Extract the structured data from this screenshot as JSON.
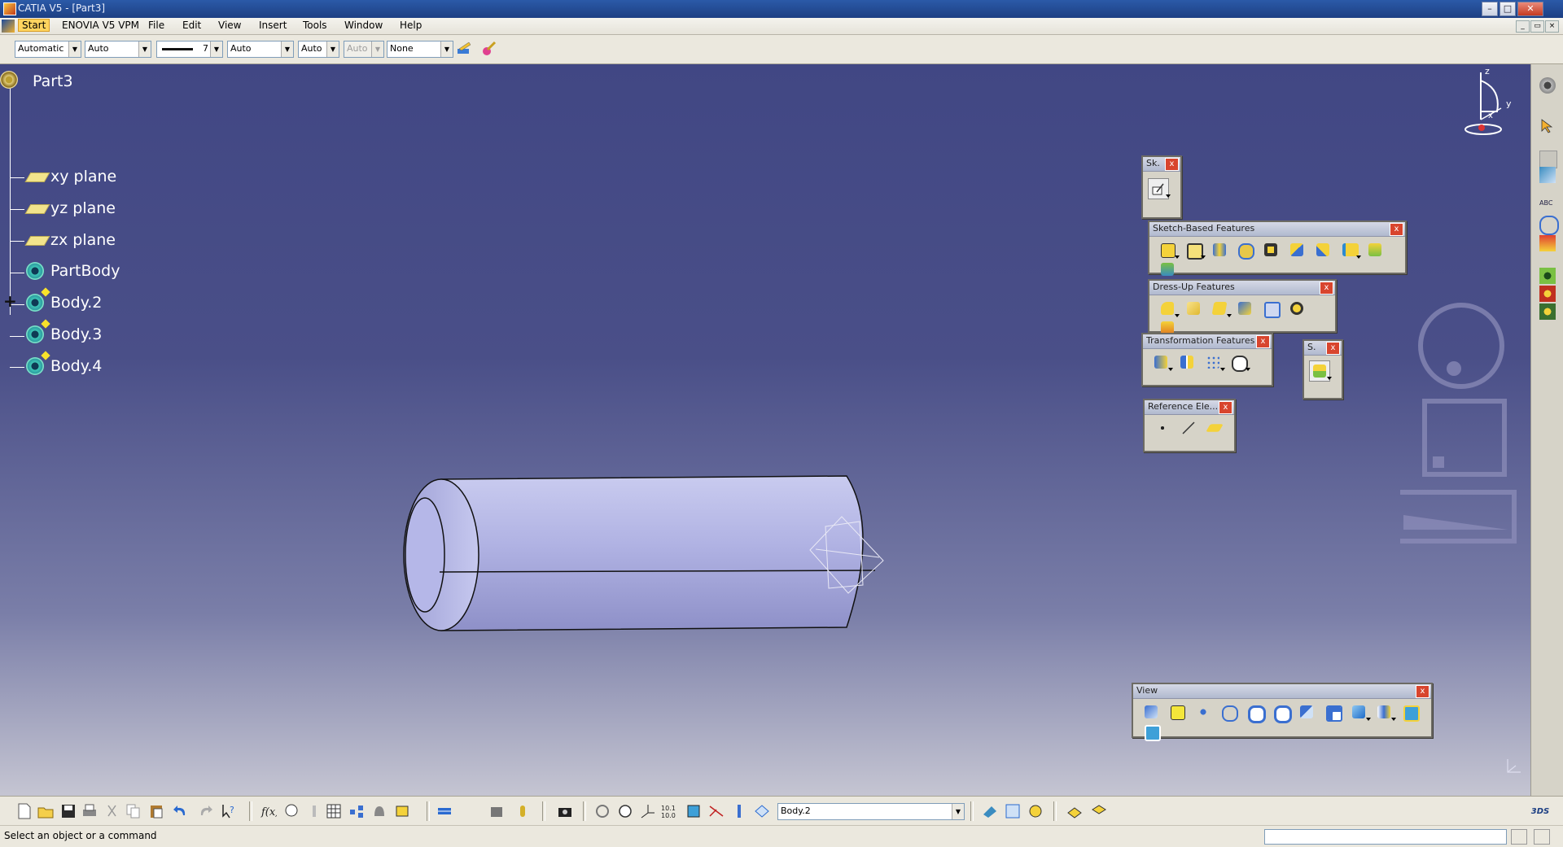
{
  "window": {
    "title": "CATIA V5 - [Part3]",
    "min": "–",
    "max": "□",
    "close": "✕"
  },
  "menu": {
    "items": [
      {
        "label": "Start"
      },
      {
        "label": "ENOVIA V5 VPM"
      },
      {
        "label": "File"
      },
      {
        "label": "Edit"
      },
      {
        "label": "View"
      },
      {
        "label": "Insert"
      },
      {
        "label": "Tools"
      },
      {
        "label": "Window"
      },
      {
        "label": "Help"
      }
    ]
  },
  "graphic_properties": {
    "fill_color": "Automatic",
    "transparency": "Auto",
    "line_weight": "7",
    "line_type": "Auto",
    "point_symbol": "Auto",
    "layer_disabled": "Auto",
    "layer": "None"
  },
  "tree": {
    "root": "Part3",
    "nodes": [
      {
        "label": "xy plane",
        "icon": "plane-icon"
      },
      {
        "label": "yz plane",
        "icon": "plane-icon"
      },
      {
        "label": "zx plane",
        "icon": "plane-icon"
      },
      {
        "label": "PartBody",
        "icon": "body-icon"
      },
      {
        "label": "Body.2",
        "icon": "body-icon",
        "expander": "+"
      },
      {
        "label": "Body.3",
        "icon": "body-icon"
      },
      {
        "label": "Body.4",
        "icon": "body-icon"
      }
    ]
  },
  "compass": {
    "z": "z",
    "y": "y",
    "x": "x"
  },
  "toolbars": {
    "sketcher": {
      "title": "Sk.",
      "close": "x"
    },
    "sketch_based": {
      "title": "Sketch-Based Features",
      "close": "x"
    },
    "dress_up": {
      "title": "Dress-Up Features",
      "close": "x"
    },
    "transformation": {
      "title": "Transformation Features",
      "close": "x"
    },
    "surface": {
      "title": "S.",
      "close": "x"
    },
    "reference": {
      "title": "Reference Ele...",
      "close": "x"
    },
    "view": {
      "title": "View",
      "close": "x"
    }
  },
  "bottom_toolbar": {
    "current_body": "Body.2"
  },
  "status": {
    "message": "Select an object or a command"
  },
  "colors": {
    "viewport_top": "#414784",
    "viewport_bottom": "#c5c5d2",
    "part_fill": "#b3b4e3",
    "tree_text": "#ffffff",
    "menu_highlight": "#ffd45f"
  }
}
